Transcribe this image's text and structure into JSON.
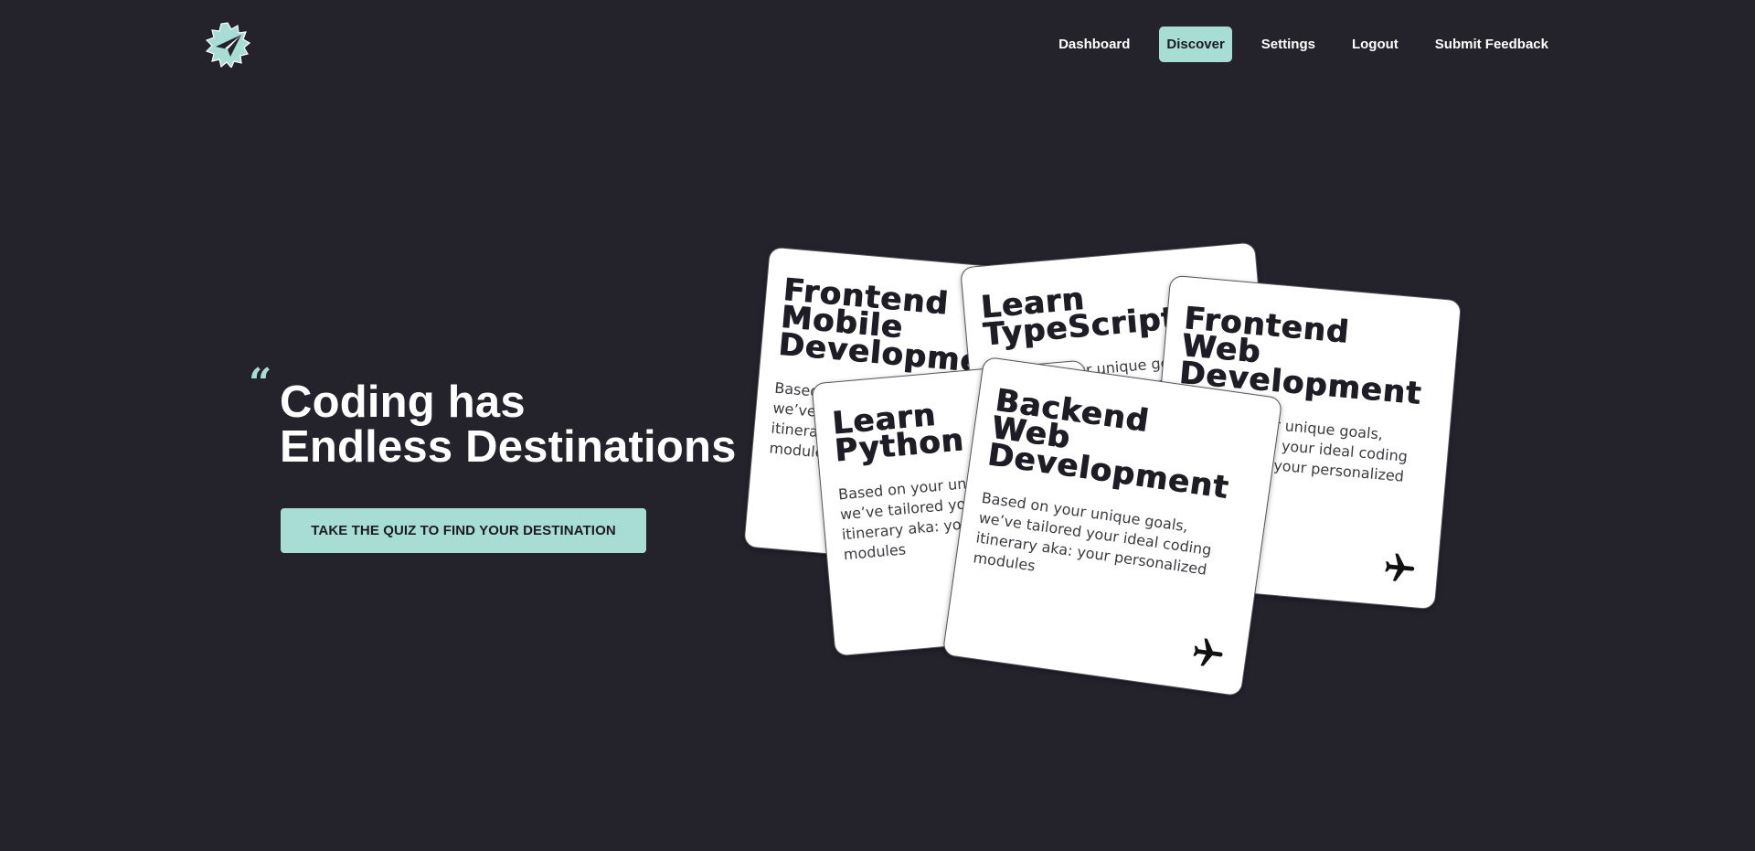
{
  "header": {
    "logo_icon": "paper-plane-badge-icon",
    "nav": [
      {
        "label": "Dashboard",
        "active": false
      },
      {
        "label": "Discover",
        "active": true
      },
      {
        "label": "Settings",
        "active": false
      },
      {
        "label": "Logout",
        "active": false
      },
      {
        "label": "Submit Feedback",
        "active": false
      }
    ]
  },
  "hero": {
    "quote_mark": "“",
    "title_line1": "Coding has",
    "title_line2": "Endless Destinations",
    "cta_label": "TAKE THE QUIZ TO FIND YOUR DESTINATION"
  },
  "cards": {
    "frontend_mobile": {
      "title_line1": "Frontend",
      "title_line2": "Mobile",
      "title_line3": "Development",
      "description": "Based on your unique goals, we’ve tailored your ideal coding itinerary aka: your personalized modules"
    },
    "typescript": {
      "title_line1": "Learn",
      "title_line2": "TypeScript",
      "description": "Based on your unique goals, we’ve tailored your ideal coding itinerary aka: your personalized modules"
    },
    "frontend_web": {
      "title_line1": "Frontend",
      "title_line2": "Web",
      "title_line3": "Development",
      "description": "Based on your unique goals, we’ve tailored your ideal coding itinerary aka: your personalized modules",
      "icon": "airplane-icon"
    },
    "python": {
      "title_line1": "Learn",
      "title_line2": "Python",
      "description": "Based on your unique goals, we’ve tailored your ideal coding itinerary aka: your personalized modules"
    },
    "backend_web": {
      "title_line1": "Backend",
      "title_line2": "Web",
      "title_line3": "Development",
      "description": "Based on your unique goals, we’ve tailored your ideal coding itinerary aka: your personalized modules",
      "icon": "airplane-icon"
    }
  },
  "colors": {
    "background": "#24232c",
    "accent": "#a8ddd6",
    "card": "#ffffff",
    "card_text": "#1e1d25"
  }
}
